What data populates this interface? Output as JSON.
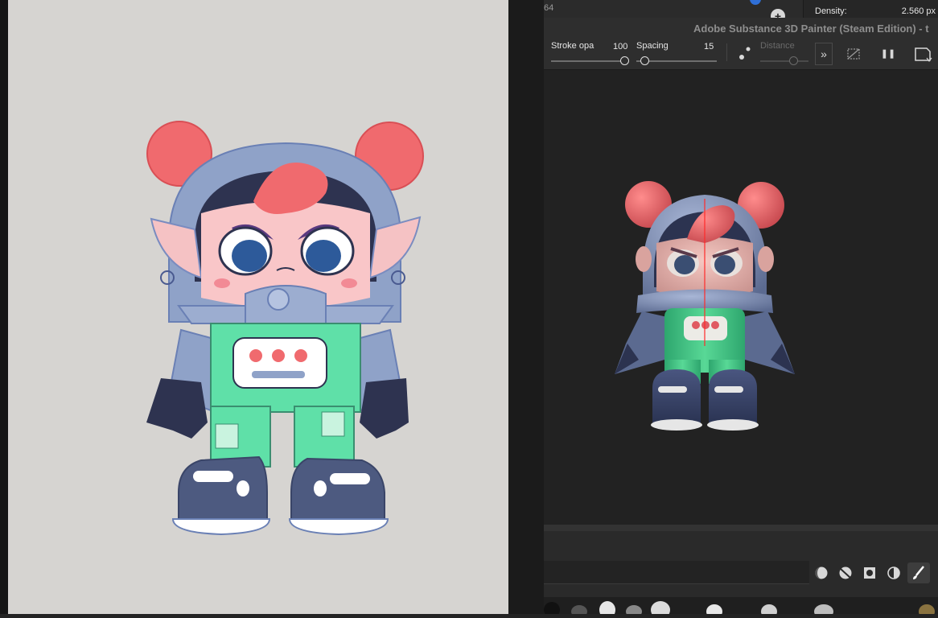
{
  "painter": {
    "top_number": "64",
    "density_label": "Density:",
    "density_value": "2.560 px",
    "window_title": "Adobe Substance 3D Painter (Steam Edition) - t"
  },
  "toolbar": {
    "stroke_label": "Stroke opa",
    "stroke_value": "100",
    "spacing_label": "Spacing",
    "spacing_value": "15",
    "distance_label": "Distance",
    "more_glyph": "»",
    "pause_glyph": "❚❚"
  },
  "colors": {
    "sketch_bg": "#d6d4d1",
    "viewport_bg": "#222222",
    "panel_bg": "#2e2e2e",
    "accent_blue": "#2f6fd6",
    "character_red": "#f06a6e",
    "character_green": "#5fe0a8",
    "character_navy": "#4d5a80",
    "helmet_blue": "#8fa2c8"
  }
}
